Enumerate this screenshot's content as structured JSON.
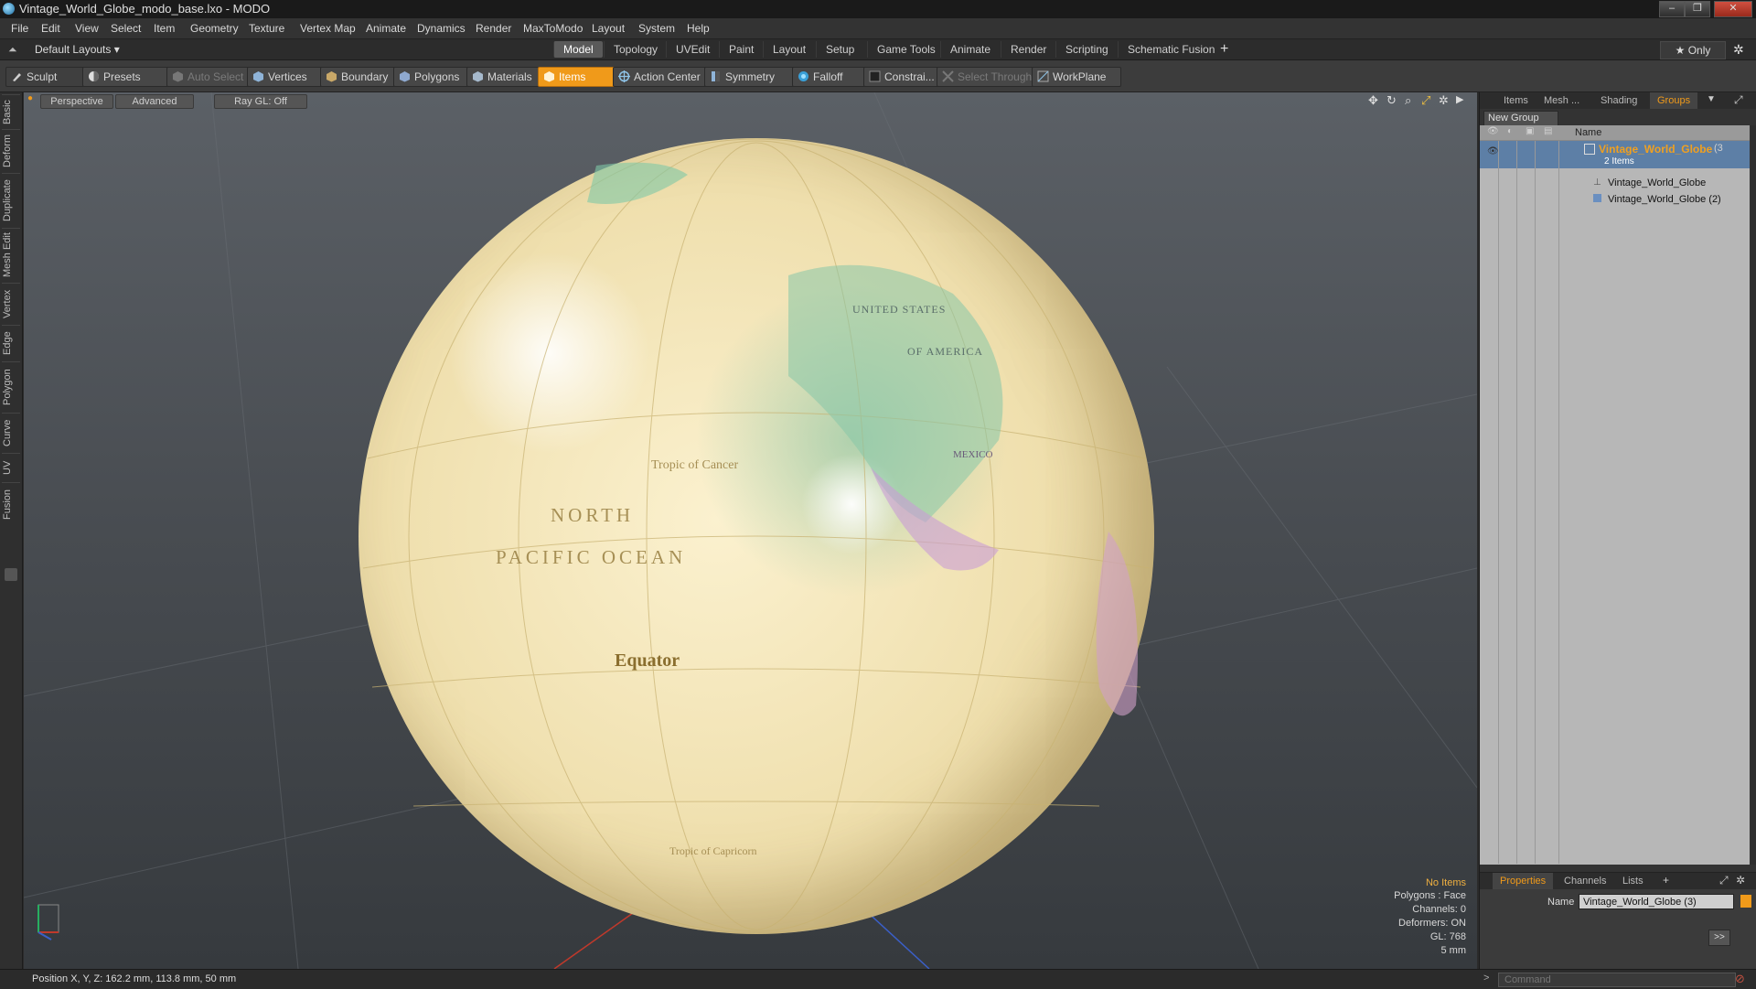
{
  "window": {
    "title": "Vintage_World_Globe_modo_base.lxo - MODO"
  },
  "menu": [
    "File",
    "Edit",
    "View",
    "Select",
    "Item",
    "Geometry",
    "Texture",
    "Vertex Map",
    "Animate",
    "Dynamics",
    "Render",
    "MaxToModo",
    "Layout",
    "System",
    "Help"
  ],
  "layouts": {
    "dropdown": "Default Layouts ▾",
    "tabs": [
      "Model",
      "Topology",
      "UVEdit",
      "Paint",
      "Layout",
      "Setup",
      "Game Tools",
      "Animate",
      "Render",
      "Scripting",
      "Schematic Fusion"
    ],
    "active": "Model",
    "only_label": "★  Only"
  },
  "toolbar": {
    "sculpt": "Sculpt",
    "presets": "Presets",
    "auto_select": "Auto Select",
    "vertices": "Vertices",
    "boundary": "Boundary",
    "polygons": "Polygons",
    "materials": "Materials",
    "items": "Items",
    "action_center": "Action Center",
    "symmetry": "Symmetry",
    "falloff": "Falloff",
    "constraints": "Constrai...",
    "select_through": "Select Through",
    "workplane": "WorkPlane"
  },
  "left_tabs": [
    "Basic",
    "Deform",
    "Duplicate",
    "Mesh Edit",
    "Vertex",
    "Edge",
    "Polygon",
    "Curve",
    "UV",
    "Fusion"
  ],
  "viewport": {
    "view": "Perspective",
    "shading": "Advanced",
    "raygl": "Ray GL: Off",
    "globe_labels": {
      "us": "UNITED STATES",
      "america": "OF AMERICA",
      "mexico": "MEXICO",
      "cancer": "Tropic of Cancer",
      "north": "NORTH",
      "pacific": "PACIFIC  OCEAN",
      "equator": "Equator",
      "capricorn": "Tropic of Capricorn"
    },
    "stats": {
      "no_items": "No Items",
      "polygons": "Polygons : Face",
      "channels": "Channels: 0",
      "deformers": "Deformers: ON",
      "gl": "GL: 768",
      "scale": "5 mm"
    }
  },
  "right_panel": {
    "tabs": [
      "Items",
      "Mesh ...",
      "Shading",
      "Groups"
    ],
    "active_tab": "Groups",
    "new_group": "New Group",
    "name_col": "Name",
    "group_name": "Vintage_World_Globe",
    "group_count": "(3",
    "group_sub": "2 Items",
    "children": [
      "Vintage_World_Globe",
      "Vintage_World_Globe (2)"
    ],
    "prop_tabs": [
      "Properties",
      "Channels",
      "Lists"
    ],
    "active_prop_tab": "Properties",
    "name_label": "Name",
    "name_value": "Vintage_World_Globe (3)",
    "more": ">>"
  },
  "status": {
    "position": "Position X, Y, Z:   162.2 mm, 113.8 mm, 50 mm",
    "command_placeholder": "Command"
  },
  "colors": {
    "accent": "#f09a1a",
    "selection": "#5d7fa6"
  }
}
